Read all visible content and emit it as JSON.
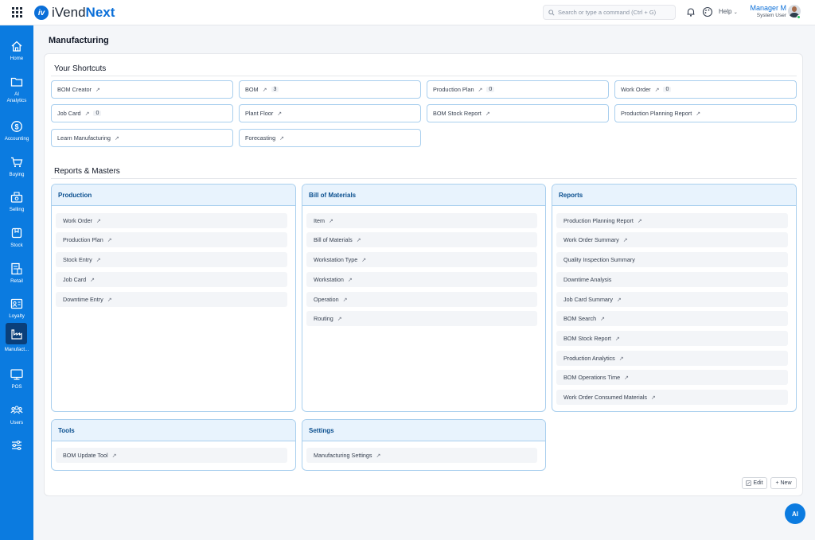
{
  "app": {
    "logo_text_a": "iVend",
    "logo_text_b": "Next",
    "logo_mark": "iv"
  },
  "topbar": {
    "search_placeholder": "Search or type a command (Ctrl + G)",
    "help_label": "Help",
    "user_name": "Manager M",
    "user_role": "System User"
  },
  "sidebar": {
    "items": [
      {
        "label": "Home",
        "icon": "home-icon"
      },
      {
        "label": "AI Analytics",
        "icon": "folder-icon"
      },
      {
        "label": "Accounting",
        "icon": "dollar-icon"
      },
      {
        "label": "Buying",
        "icon": "cart-icon"
      },
      {
        "label": "Selling",
        "icon": "register-icon"
      },
      {
        "label": "Stock",
        "icon": "box-icon"
      },
      {
        "label": "Retail",
        "icon": "receipt-icon"
      },
      {
        "label": "Loyalty",
        "icon": "id-card-icon"
      },
      {
        "label": "Manufact...",
        "icon": "factory-icon"
      },
      {
        "label": "POS",
        "icon": "monitor-icon"
      },
      {
        "label": "Users",
        "icon": "users-icon"
      },
      {
        "label": "",
        "icon": "sliders-icon"
      }
    ]
  },
  "page": {
    "title": "Manufacturing"
  },
  "shortcuts": {
    "title": "Your Shortcuts",
    "items": [
      {
        "label": "BOM Creator",
        "count": ""
      },
      {
        "label": "BOM",
        "count": "3"
      },
      {
        "label": "Production Plan",
        "count": "0"
      },
      {
        "label": "Work Order",
        "count": "0"
      },
      {
        "label": "Job Card",
        "count": "0"
      },
      {
        "label": "Plant Floor",
        "count": ""
      },
      {
        "label": "BOM Stock Report",
        "count": ""
      },
      {
        "label": "Production Planning Report",
        "count": ""
      },
      {
        "label": "Learn Manufacturing",
        "count": ""
      },
      {
        "label": "Forecasting",
        "count": ""
      }
    ],
    "arrow": "↗"
  },
  "reports_masters": {
    "title": "Reports & Masters",
    "cards": [
      {
        "title": "Production",
        "links": [
          {
            "label": "Work Order",
            "arrow": true
          },
          {
            "label": "Production Plan",
            "arrow": true
          },
          {
            "label": "Stock Entry",
            "arrow": true
          },
          {
            "label": "Job Card",
            "arrow": true
          },
          {
            "label": "Downtime Entry",
            "arrow": true
          }
        ]
      },
      {
        "title": "Bill of Materials",
        "links": [
          {
            "label": "Item",
            "arrow": true
          },
          {
            "label": "Bill of Materials",
            "arrow": true
          },
          {
            "label": "Workstation Type",
            "arrow": true
          },
          {
            "label": "Workstation",
            "arrow": true
          },
          {
            "label": "Operation",
            "arrow": true
          },
          {
            "label": "Routing",
            "arrow": true
          }
        ]
      },
      {
        "title": "Reports",
        "links": [
          {
            "label": "Production Planning Report",
            "arrow": true
          },
          {
            "label": "Work Order Summary",
            "arrow": true
          },
          {
            "label": "Quality Inspection Summary",
            "arrow": false
          },
          {
            "label": "Downtime Analysis",
            "arrow": false
          },
          {
            "label": "Job Card Summary",
            "arrow": true
          },
          {
            "label": "BOM Search",
            "arrow": true
          },
          {
            "label": "BOM Stock Report",
            "arrow": true
          },
          {
            "label": "Production Analytics",
            "arrow": true
          },
          {
            "label": "BOM Operations Time",
            "arrow": true
          },
          {
            "label": "Work Order Consumed Materials",
            "arrow": true
          }
        ]
      },
      {
        "title": "Tools",
        "links": [
          {
            "label": "BOM Update Tool",
            "arrow": true
          }
        ]
      },
      {
        "title": "Settings",
        "links": [
          {
            "label": "Manufacturing Settings",
            "arrow": true
          }
        ]
      }
    ]
  },
  "actions": {
    "edit_label": "Edit",
    "new_label": "+ New",
    "ai_label": "AI"
  },
  "colors": {
    "brand": "#0b7be0",
    "card_border": "#a9cfee",
    "card_header": "#e8f3fd"
  }
}
